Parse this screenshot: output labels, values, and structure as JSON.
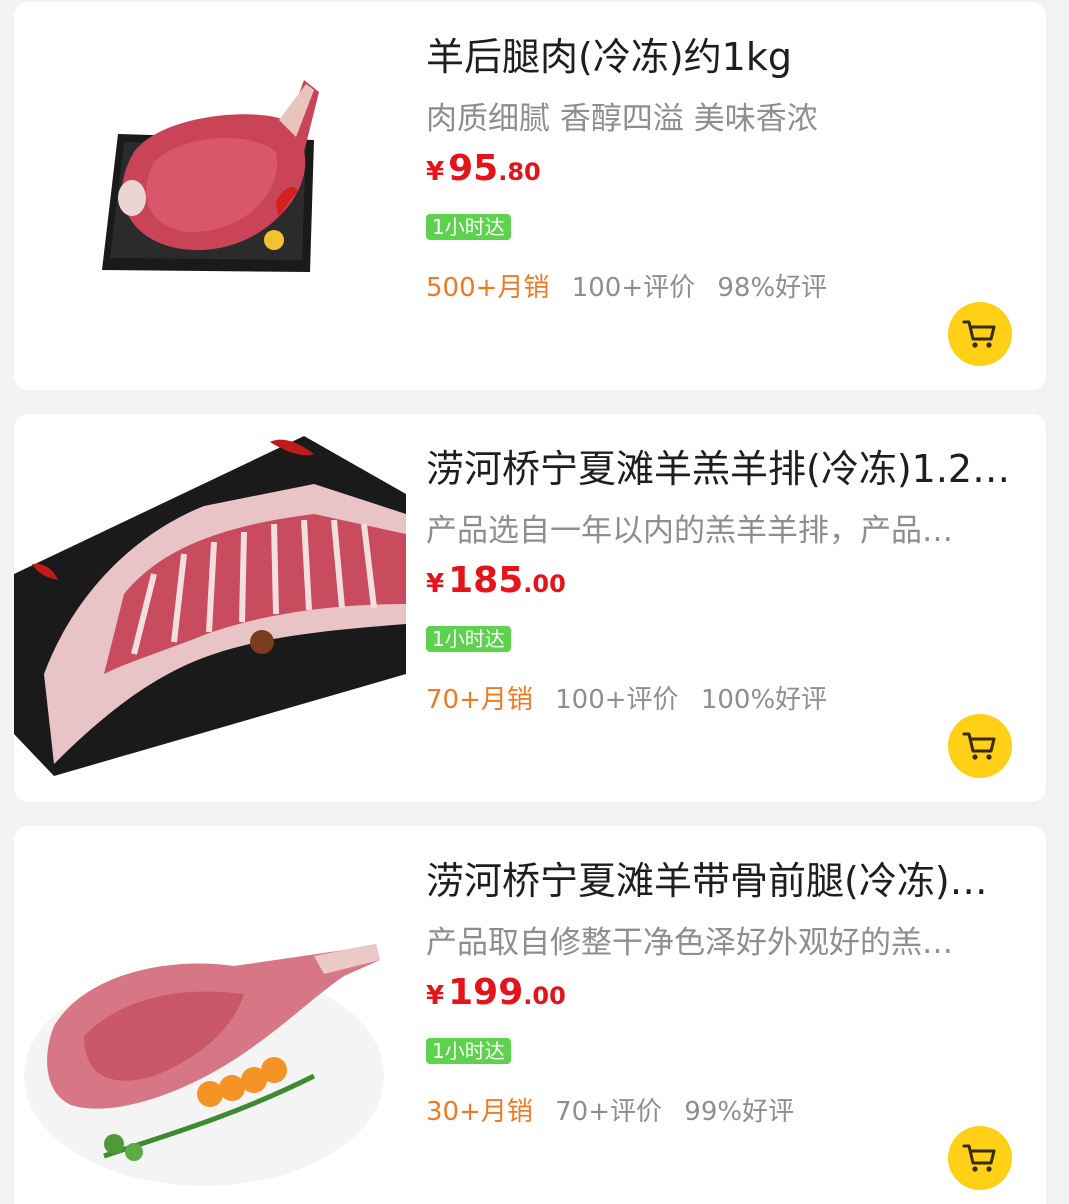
{
  "products": [
    {
      "title": "羊后腿肉(冷冻)约1kg",
      "desc": "肉质细腻 香醇四溢 美味香浓",
      "price": {
        "symbol": "¥",
        "int": "95",
        "dec": "80"
      },
      "badge": "1小时达",
      "sales": "500+月销",
      "reviews": "100+评价",
      "rate": "98%好评",
      "image_icon": "lamb-leg-image"
    },
    {
      "title": "涝河桥宁夏滩羊羔羊排(冷冻)1.2…",
      "desc": "产品选自一年以内的羔羊羊排，产品…",
      "price": {
        "symbol": "¥",
        "int": "185",
        "dec": "00"
      },
      "badge": "1小时达",
      "sales": "70+月销",
      "reviews": "100+评价",
      "rate": "100%好评",
      "image_icon": "lamb-ribs-image"
    },
    {
      "title": "涝河桥宁夏滩羊带骨前腿(冷冻)…",
      "desc": "产品取自修整干净色泽好外观好的羔…",
      "price": {
        "symbol": "¥",
        "int": "199",
        "dec": "00"
      },
      "badge": "1小时达",
      "sales": "30+月销",
      "reviews": "70+评价",
      "rate": "99%好评",
      "image_icon": "lamb-foreleg-image"
    }
  ],
  "colors": {
    "price": "#e4141a",
    "badge": "#5ed24e",
    "sales": "#f07a22",
    "cart_button": "#ffd016"
  },
  "icons": {
    "cart": "shopping-cart-icon"
  }
}
